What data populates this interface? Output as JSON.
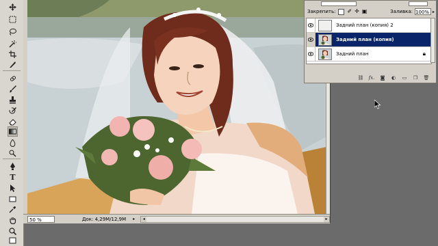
{
  "document": {
    "zoom": "50 %",
    "doc_info": "Док: 4,29M/12,9M",
    "status_arrow": "▸"
  },
  "layers_panel": {
    "lock_label": "Закрепить:",
    "fill_label": "Заливка:",
    "fill_value": "100%",
    "fill_arrow": "▸",
    "layers": [
      {
        "name": "Задний план (копия) 2",
        "selected": false,
        "locked": false,
        "thumb": "white"
      },
      {
        "name": "Задний план (копия)",
        "selected": true,
        "locked": false,
        "thumb": "photo"
      },
      {
        "name": "Задний план",
        "selected": false,
        "locked": true,
        "thumb": "photo"
      }
    ],
    "footer_icons": [
      "link-icon",
      "fx-icon",
      "mask-icon",
      "adjustment-icon",
      "folder-icon",
      "new-layer-icon",
      "trash-icon"
    ],
    "fx_label": "fx."
  },
  "toolbar": {
    "tools": [
      "move-tool-icon",
      "marquee-tool-icon",
      "lasso-tool-icon",
      "magic-wand-tool-icon",
      "crop-tool-icon",
      "slice-tool-icon",
      "healing-brush-tool-icon",
      "brush-tool-icon",
      "clone-stamp-tool-icon",
      "history-brush-tool-icon",
      "eraser-tool-icon",
      "gradient-tool-icon",
      "blur-tool-icon",
      "dodge-tool-icon",
      "pen-tool-icon",
      "type-tool-icon",
      "path-selection-tool-icon",
      "shape-tool-icon",
      "notes-tool-icon",
      "eyedropper-tool-icon",
      "hand-tool-icon",
      "zoom-tool-icon"
    ],
    "type_glyph": "T",
    "active_tool": "gradient-tool-icon"
  }
}
